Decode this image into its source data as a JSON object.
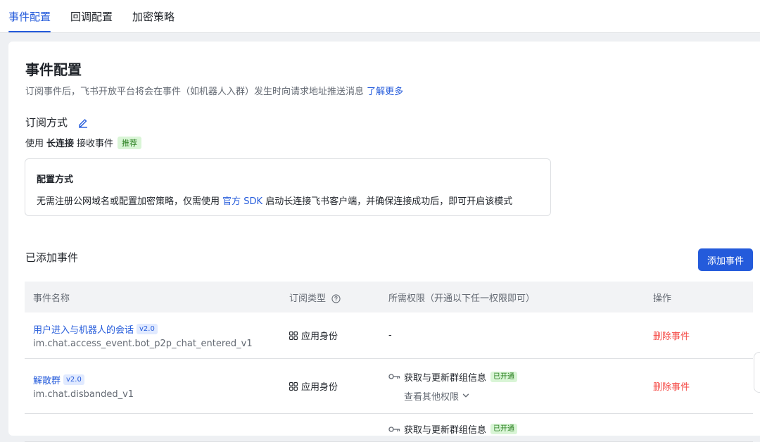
{
  "tabs": [
    "事件配置",
    "回调配置",
    "加密策略"
  ],
  "page": {
    "title": "事件配置",
    "description": "订阅事件后，飞书开放平台将会在事件（如机器人入群）发生时向请求地址推送消息",
    "learn_more": "了解更多"
  },
  "subscription": {
    "title": "订阅方式",
    "prefix": "使用",
    "mode": "长连接",
    "suffix": "接收事件",
    "badge": "推荐"
  },
  "config_box": {
    "title": "配置方式",
    "text_before": "无需注册公网域名或配置加密策略，仅需使用",
    "sdk_link": "官方 SDK",
    "text_after": "启动长连接飞书客户端，并确保连接成功后，即可开启该模式"
  },
  "events": {
    "title": "已添加事件",
    "add_button": "添加事件",
    "columns": [
      "事件名称",
      "订阅类型",
      "所需权限（开通以下任一权限即可）",
      "操作"
    ],
    "rows": [
      {
        "name": "用户进入与机器人的会话",
        "version": "v2.0",
        "code": "im.chat.access_event.bot_p2p_chat_entered_v1",
        "type": "应用身份",
        "permission": "-",
        "action": "删除事件"
      },
      {
        "name": "解散群",
        "version": "v2.0",
        "code": "im.chat.disbanded_v1",
        "type": "应用身份",
        "permission": "获取与更新群组信息",
        "permission_status": "已开通",
        "more": "查看其他权限",
        "action": "删除事件"
      },
      {
        "permission": "获取与更新群组信息",
        "permission_status": "已开通"
      }
    ]
  },
  "colors": {
    "primary": "#245bdb",
    "danger": "#f54a45",
    "success_bg": "#d9f5d6",
    "success_text": "#237b19"
  }
}
